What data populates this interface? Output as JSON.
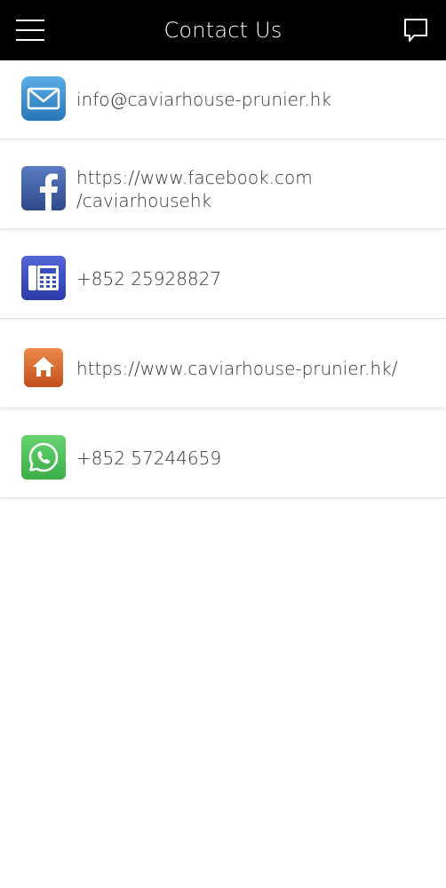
{
  "header": {
    "title": "Contact Us"
  },
  "contacts": [
    {
      "type": "email",
      "icon": "envelope-icon",
      "lines": [
        "info@caviarhouse-prunier.hk"
      ]
    },
    {
      "type": "facebook",
      "icon": "facebook-icon",
      "lines": [
        "https://www.facebook.com",
        "/caviarhousehk"
      ]
    },
    {
      "type": "phone",
      "icon": "telephone-icon",
      "lines": [
        "+852 25928827"
      ]
    },
    {
      "type": "website",
      "icon": "home-icon",
      "lines": [
        "https://www.caviarhouse-prunier.hk/"
      ]
    },
    {
      "type": "whatsapp",
      "icon": "whatsapp-icon",
      "lines": [
        "+852 57244659"
      ]
    }
  ],
  "colors": {
    "header_bg": "#000000",
    "header_text": "#ffffff",
    "email_icon": "#3a8fd0",
    "facebook_icon": "#3b5998",
    "phone_icon": "#3a4fc0",
    "home_icon": "#d9622b",
    "whatsapp_icon": "#4cc35a"
  }
}
